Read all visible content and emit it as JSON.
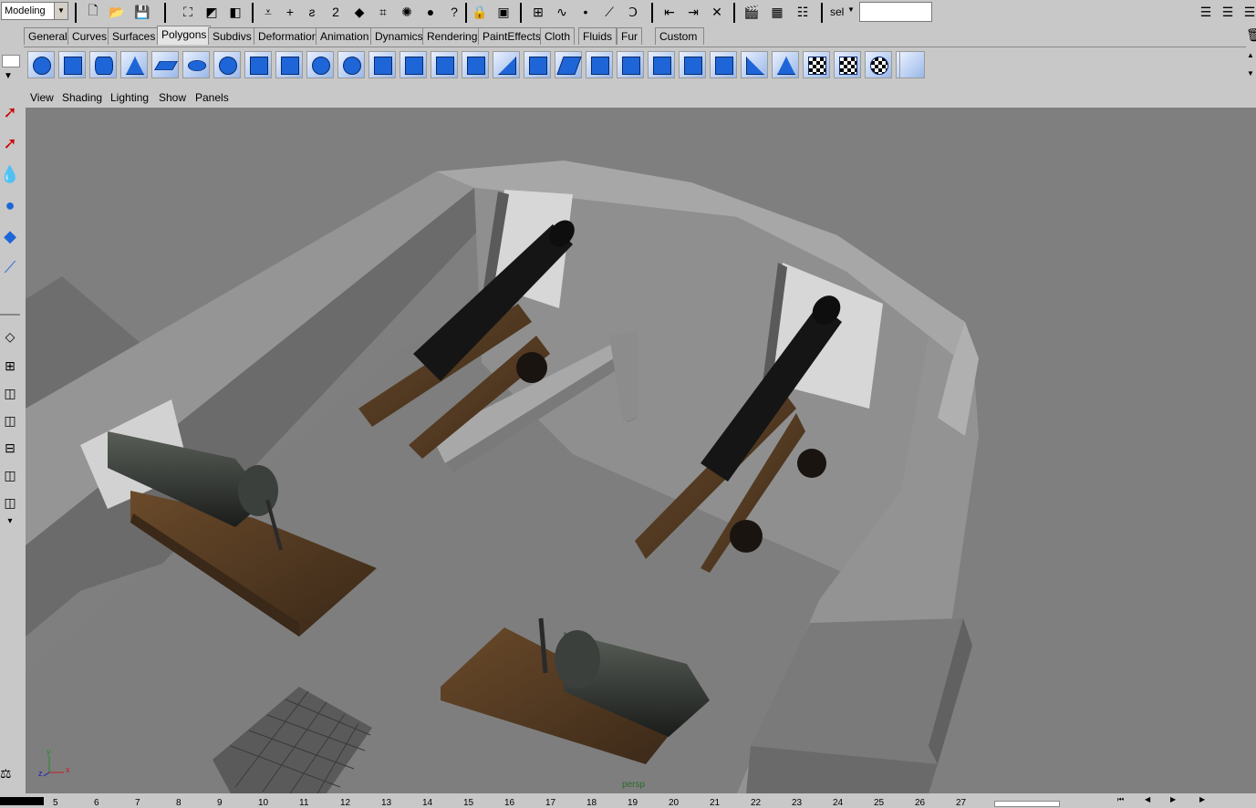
{
  "status_line": {
    "mode": "Modeling",
    "sel_label": "sel",
    "sel_value": ""
  },
  "shelf_tabs": [
    "General",
    "Curves",
    "Surfaces",
    "Polygons",
    "Subdivs",
    "Deformation",
    "Animation",
    "Dynamics",
    "Rendering",
    "PaintEffects",
    "Cloth",
    "Fluids",
    "Fur",
    "Custom"
  ],
  "active_tab": "Polygons",
  "panel_menu": [
    "View",
    "Shading",
    "Lighting",
    "Show",
    "Panels"
  ],
  "axis": {
    "x": "x",
    "y": "y",
    "z": "z"
  },
  "camera_label": "persp",
  "timeline_ticks": [
    "5",
    "6",
    "7",
    "8",
    "9",
    "10",
    "11",
    "12",
    "13",
    "14",
    "15",
    "16",
    "17",
    "18",
    "19",
    "20",
    "21",
    "22",
    "23",
    "24",
    "25",
    "26",
    "27"
  ],
  "colors": {
    "ui_bg": "#c8c8c8",
    "viewport_bg": "#7f7f7f",
    "shelf_blue": "#1e66d8"
  }
}
